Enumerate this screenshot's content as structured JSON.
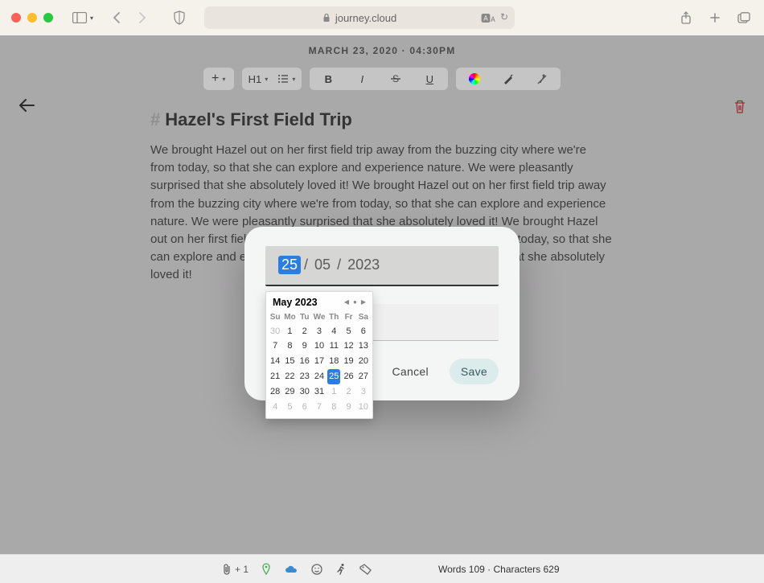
{
  "browser": {
    "url_host": "journey.cloud"
  },
  "header": {
    "datetime": "MARCH 23, 2020 · 04:30PM"
  },
  "toolbar": {
    "heading_label": "H1",
    "bold": "B",
    "italic": "I",
    "underline": "U"
  },
  "document": {
    "title": "Hazel's First Field Trip",
    "body": "We brought Hazel out on her first field trip away from the buzzing city where we're from today, so that she can explore and experience nature. We were pleasantly surprised that she absolutely loved it! We brought Hazel out on her first field trip away from the buzzing city where we're from today, so that she can explore and experience nature. We were pleasantly surprised that she absolutely loved it! We brought Hazel out on her first field trip away from the buzzing city where we're from today, so that she can explore and experience nature. We were pleasantly surprised that she absolutely loved it!"
  },
  "modal": {
    "date": {
      "day": "25",
      "month": "05",
      "year": "2023"
    },
    "cancel_label": "Cancel",
    "save_label": "Save"
  },
  "calendar": {
    "title": "May 2023",
    "dow": [
      "Su",
      "Mo",
      "Tu",
      "We",
      "Th",
      "Fr",
      "Sa"
    ],
    "leading": [
      "30"
    ],
    "days": [
      "1",
      "2",
      "3",
      "4",
      "5",
      "6",
      "7",
      "8",
      "9",
      "10",
      "11",
      "12",
      "13",
      "14",
      "15",
      "16",
      "17",
      "18",
      "19",
      "20",
      "21",
      "22",
      "23",
      "24",
      "25",
      "26",
      "27",
      "28",
      "29",
      "30",
      "31"
    ],
    "trailing": [
      "1",
      "2",
      "3",
      "4",
      "5",
      "6",
      "7",
      "8",
      "9",
      "10"
    ],
    "selected": "25"
  },
  "footer": {
    "attachment_count": "+ 1",
    "stats": "Words 109 · Characters 629"
  }
}
